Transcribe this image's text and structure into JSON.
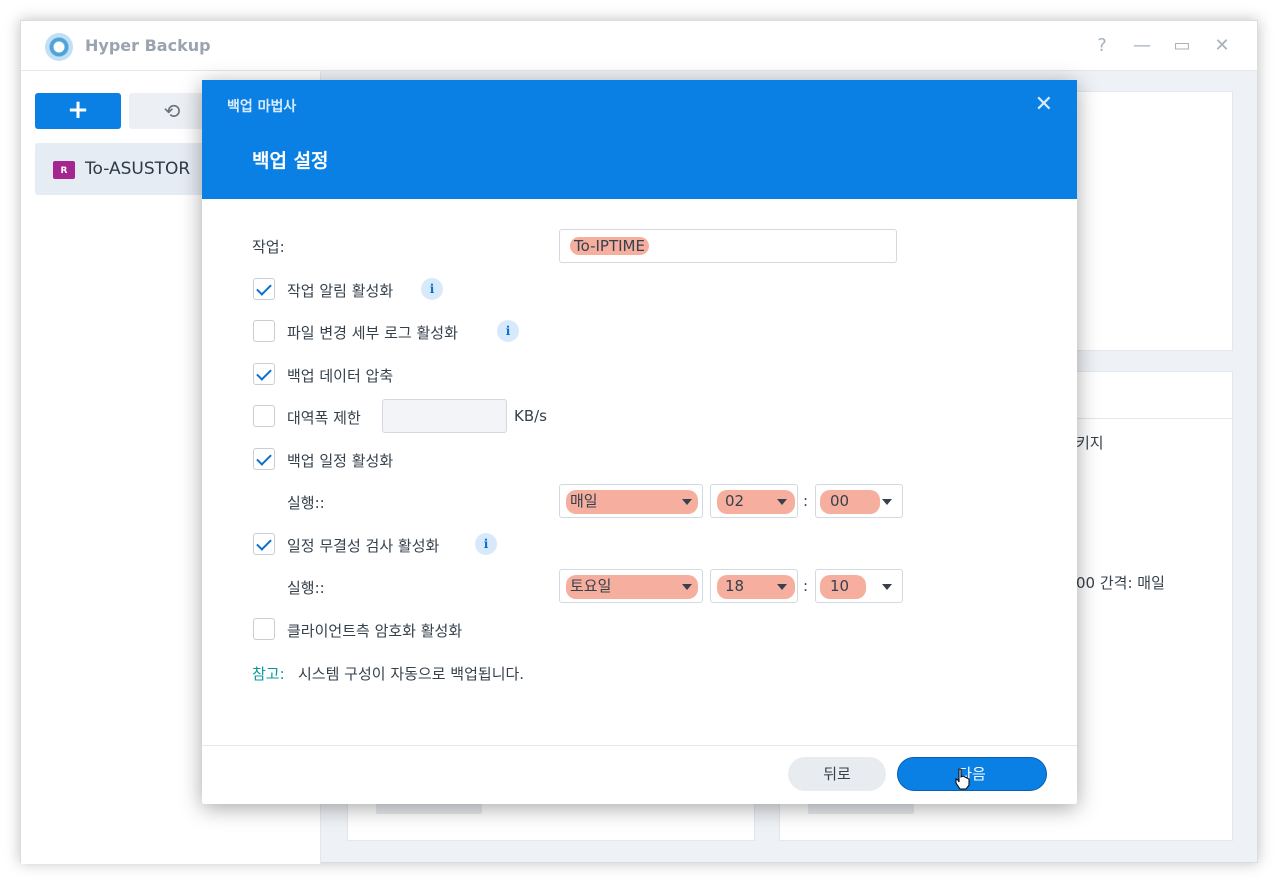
{
  "app": {
    "title": "Hyper Backup",
    "help": "?",
    "minimize": "—",
    "maximize": "▭",
    "close": "✕"
  },
  "sidebar": {
    "add_label": "+",
    "restore_icon": "⟲",
    "task": {
      "label": "To-ASUSTOR",
      "badge": "R"
    }
  },
  "background": {
    "text_package": "키지",
    "text_interval": "00 간격: 매일"
  },
  "modal": {
    "wizard_label": "백업 마법사",
    "close": "✕",
    "title": "백업 설정",
    "task_label": "작업:",
    "task_value": "To-IPTIME",
    "options": [
      {
        "label": "작업 알림 활성화",
        "checked": true,
        "info": true
      },
      {
        "label": "파일 변경 세부 로그 활성화",
        "checked": false,
        "info": true
      },
      {
        "label": "백업 데이터 압축",
        "checked": true,
        "info": false
      },
      {
        "label": "대역폭 제한",
        "checked": false,
        "info": false
      },
      {
        "label": "백업 일정 활성화",
        "checked": true,
        "info": false
      },
      {
        "label": "일정 무결성 검사 활성화",
        "checked": true,
        "info": true
      },
      {
        "label": "클라이언트측 암호화 활성화",
        "checked": false,
        "info": false
      }
    ],
    "bandwidth_unit": "KB/s",
    "bandwidth_value": "",
    "schedule": {
      "run_label": "실행::",
      "frequency": "매일",
      "hour": "02",
      "minute": "00"
    },
    "integrity": {
      "run_label": "실행::",
      "day": "토요일",
      "hour": "18",
      "minute": "10"
    },
    "colon": ":",
    "info_glyph": "i",
    "note_label": "참고:",
    "note_text": "시스템 구성이 자동으로 백업됩니다.",
    "back_label": "뒤로",
    "next_label": "다음"
  },
  "colors": {
    "accent": "#0a7fe4",
    "highlight": "#f0785f",
    "note": "#0b9a9a"
  }
}
